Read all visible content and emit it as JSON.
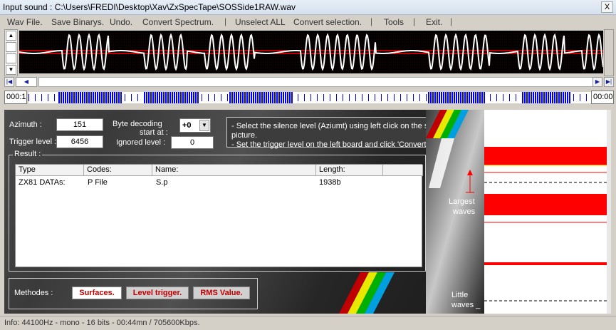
{
  "window": {
    "title": "Input sound : C:\\Users\\FREDI\\Desktop\\Xav\\ZxSpecTape\\SOSSide1RAW.wav",
    "close_glyph": "X"
  },
  "menu": {
    "items": [
      "Wav File.",
      "Save Binarys.",
      "Undo.",
      "Convert Spectrum.",
      "Unselect ALL",
      "Convert selection.",
      "Tools",
      "Exit."
    ],
    "separator": "|"
  },
  "timeline": {
    "start": "000:1",
    "end": "00:00"
  },
  "controls": {
    "azimuth_label": "Azimuth :",
    "azimuth_value": "151",
    "trigger_label": "Trigger level :",
    "trigger_value": "6456",
    "byte_decoding_label": "Byte decoding",
    "start_at_label": "start at :",
    "byte_decoding_value": "+0",
    "ignored_label": "Ignored level :",
    "ignored_value": "0"
  },
  "info": {
    "line1": "- Select the silence level (Aziumt) using left click on the sound picture.",
    "line2": "- Set the trigger level on the left board and click 'Convert blocs'."
  },
  "result": {
    "legend": "Result :",
    "columns": [
      "Type",
      "Codes:",
      "Name:",
      "Length:"
    ],
    "rows": [
      {
        "type": "ZX81 DATAs:",
        "codes": "P File",
        "name": "S.p",
        "length": "1938b"
      }
    ]
  },
  "methods": {
    "label": "Methodes :",
    "surfaces": "Surfaces.",
    "level_trigger": "Level trigger.",
    "rms_value": "RMS Value."
  },
  "right_panel": {
    "largest": "Largest",
    "largest_waves": "waves",
    "little": "Little",
    "little_waves": "waves _"
  },
  "status": {
    "text": "Info: 44100Hz - mono - 16 bits - 00:44mn / 705600Kbps."
  },
  "colors": {
    "accent_red": "#ff0000",
    "wave": "#ffffff",
    "method_text": "#c00000",
    "timeline_blue": "#0000ff"
  }
}
